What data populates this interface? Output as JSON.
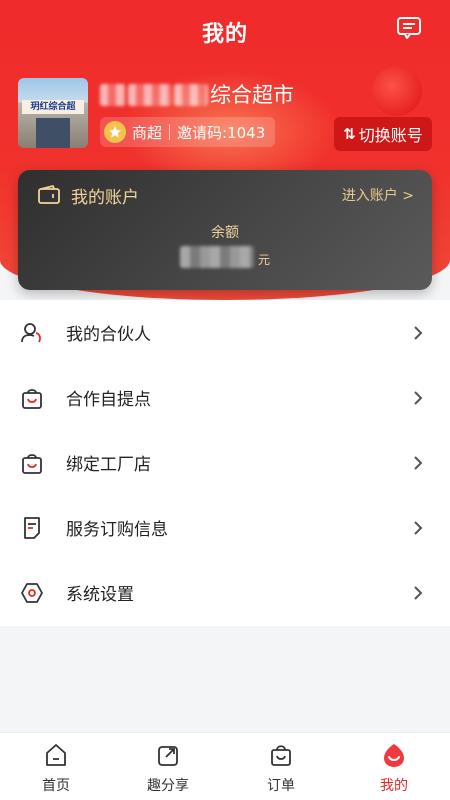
{
  "header": {
    "title": "我的"
  },
  "store": {
    "name_visible": "综合超市",
    "thumb_sign": "玥红综合超",
    "type": "商超",
    "invite_code": "邀请码:1043",
    "switch_label": "切换账号",
    "switch_arrows": "⇅"
  },
  "account": {
    "title": "我的账户",
    "enter_label": "进入账户 >",
    "balance_label": "余额",
    "balance_unit": "元"
  },
  "menu": {
    "items": [
      {
        "label": "我的合伙人",
        "icon": "partner-icon"
      },
      {
        "label": "合作自提点",
        "icon": "bag-icon"
      },
      {
        "label": "绑定工厂店",
        "icon": "bag-icon"
      },
      {
        "label": "服务订购信息",
        "icon": "document-icon"
      },
      {
        "label": "系统设置",
        "icon": "settings-icon"
      }
    ]
  },
  "tabs": [
    {
      "label": "首页",
      "icon": "home-icon"
    },
    {
      "label": "趣分享",
      "icon": "share-icon"
    },
    {
      "label": "订单",
      "icon": "order-bag-icon"
    },
    {
      "label": "我的",
      "icon": "profile-icon",
      "active": true
    }
  ],
  "colors": {
    "brand_red": "#ef2b2b",
    "gold": "#f3d49b",
    "active_tab": "#e8272b"
  }
}
